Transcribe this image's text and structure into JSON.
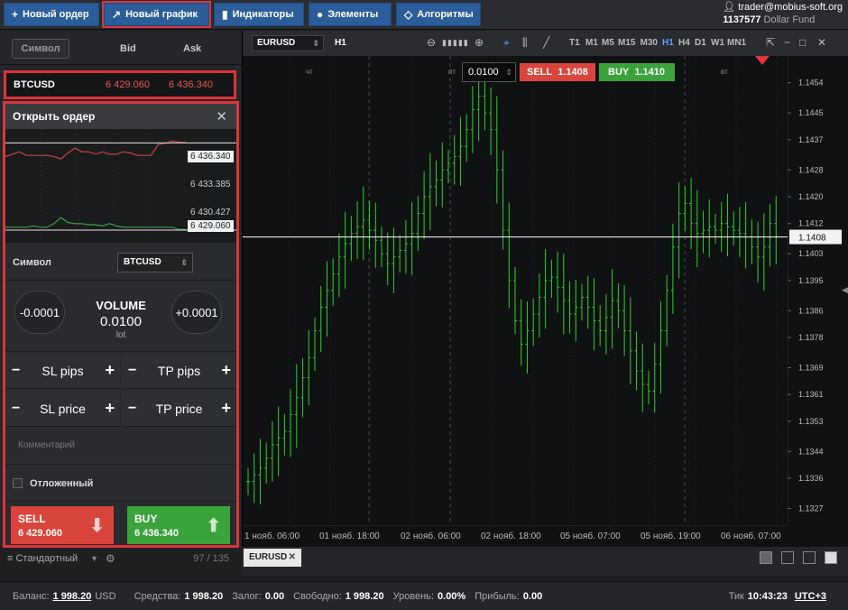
{
  "toolbar": {
    "new_order": "Новый ордер",
    "new_chart": "Новый график",
    "indicators": "Индикаторы",
    "elements": "Элементы",
    "algorithms": "Алгоритмы"
  },
  "account": {
    "email": "trader@mobius-soft.org",
    "number": "1137577",
    "fund": "Dollar Fund"
  },
  "watchlist": {
    "symbol_button": "Символ",
    "bid_header": "Bid",
    "ask_header": "Ask",
    "rows": [
      {
        "symbol": "BTCUSD",
        "bid": "6 429.060",
        "ask": "6 436.340"
      }
    ]
  },
  "order_panel": {
    "title": "Открыть ордер",
    "close": "✕",
    "mini_chart": {
      "price_labels": [
        "6 436.340",
        "6 433.385",
        "6 430.427",
        "6 429.060"
      ],
      "ask_series": [
        6435.2,
        6435.4,
        6435.6,
        6435.3,
        6435.3,
        6435.3,
        6435.3,
        6435.2,
        6435.0,
        6435.5,
        6435.9,
        6435.6,
        6435.6,
        6435.4,
        6435.6,
        6435.4,
        6435.4,
        6435.6,
        6435.5,
        6435.3,
        6435.3,
        6435.3,
        6436.2,
        6436.3,
        6436.5,
        6436.4,
        6436.4
      ],
      "bid_series": [
        6429.3,
        6429.3,
        6429.3,
        6429.3,
        6429.4,
        6429.3,
        6429.3,
        6429.6,
        6430.1,
        6429.7,
        6429.6,
        6429.6,
        6429.5,
        6429.5,
        6429.4,
        6429.6,
        6429.4,
        6429.3,
        6429.3,
        6429.3,
        6429.3,
        6429.3,
        6429.3,
        6429.3,
        6429.3,
        6429.1,
        6429.1
      ]
    },
    "symbol_label": "Символ",
    "symbol_value": "BTCUSD",
    "volume_minus": "-0.0001",
    "volume_plus": "+0.0001",
    "volume_title": "VOLUME",
    "volume_value": "0.0100",
    "volume_unit": "lot",
    "sl_pips": "SL pips",
    "tp_pips": "TP pips",
    "sl_price": "SL price",
    "tp_price": "TP price",
    "minus": "−",
    "plus": "+",
    "comment_placeholder": "Комментарий",
    "pending_label": "Отложенный",
    "sell_label": "SELL",
    "sell_price": "6 429.060",
    "buy_label": "BUY",
    "buy_price": "6 436.340"
  },
  "style_bar": {
    "style": "≡ Стандартный",
    "count": "97 / 135"
  },
  "chart": {
    "symbol": "EURUSD",
    "timeframe": "H1",
    "timeframes": [
      "T1",
      "M1",
      "M5",
      "M15",
      "M30",
      "H1",
      "H4",
      "D1",
      "W1",
      "MN1"
    ],
    "active_timeframe": "H1",
    "order_volume": "0.0100",
    "sell_label": "SELL",
    "sell_price": "1.1408",
    "buy_label": "BUY",
    "buy_price": "1.1410",
    "current_price": "1.1408",
    "day_labels": [
      "чт",
      "пт",
      "вт"
    ],
    "y_ticks": [
      "1.1454",
      "1.1445",
      "1.1437",
      "1.1428",
      "1.1420",
      "1.1412",
      "1.1403",
      "1.1395",
      "1.1386",
      "1.1378",
      "1.1369",
      "1.1361",
      "1.1353",
      "1.1344",
      "1.1336",
      "1.1327"
    ],
    "x_ticks": [
      "1 нояб. 06:00",
      "01 нояб. 18:00",
      "02 нояб. 06:00",
      "02 нояб. 18:00",
      "05 нояб. 07:00",
      "05 нояб. 19:00",
      "06 нояб. 07:00"
    ],
    "tab": "EURUSD"
  },
  "chart_data": {
    "type": "ohlc",
    "symbol": "EURUSD",
    "timeframe": "H1",
    "ylim": [
      1.1322,
      1.1462
    ],
    "current_price": 1.1408,
    "closes": [
      1.1335,
      1.1337,
      1.1339,
      1.1342,
      1.1346,
      1.1348,
      1.135,
      1.1355,
      1.136,
      1.1366,
      1.1372,
      1.138,
      1.1387,
      1.1392,
      1.1397,
      1.1402,
      1.1406,
      1.1409,
      1.1411,
      1.1413,
      1.141,
      1.1407,
      1.1403,
      1.14,
      1.1402,
      1.1404,
      1.1406,
      1.1409,
      1.1415,
      1.142,
      1.1423,
      1.1425,
      1.1428,
      1.143,
      1.1432,
      1.1435,
      1.144,
      1.1446,
      1.145,
      1.1445,
      1.144,
      1.1428,
      1.141,
      1.1395,
      1.1383,
      1.1376,
      1.138,
      1.1385,
      1.139,
      1.1395,
      1.1396,
      1.1393,
      1.1389,
      1.1385,
      1.1387,
      1.139,
      1.1387,
      1.1383,
      1.138,
      1.1384,
      1.1389,
      1.1386,
      1.138,
      1.1374,
      1.1368,
      1.1364,
      1.1362,
      1.137,
      1.138,
      1.1392,
      1.1405,
      1.1415,
      1.1418,
      1.1412,
      1.1409,
      1.141,
      1.1411,
      1.141,
      1.1412,
      1.1411,
      1.141,
      1.1409,
      1.1408,
      1.1405,
      1.1402,
      1.1405,
      1.1412,
      1.1408
    ]
  },
  "status": {
    "balance_k": "Баланс:",
    "balance_v": "1 998.20",
    "balance_cur": "USD",
    "funds_k": "Средства:",
    "funds_v": "1 998.20",
    "margin_k": "Залог:",
    "margin_v": "0.00",
    "free_k": "Свободно:",
    "free_v": "1 998.20",
    "level_k": "Уровень:",
    "level_v": "0.00%",
    "profit_k": "Прибыль:",
    "profit_v": "0.00",
    "tick_k": "Тик",
    "tick_v": "10:43:23",
    "tz": "UTC+3"
  }
}
